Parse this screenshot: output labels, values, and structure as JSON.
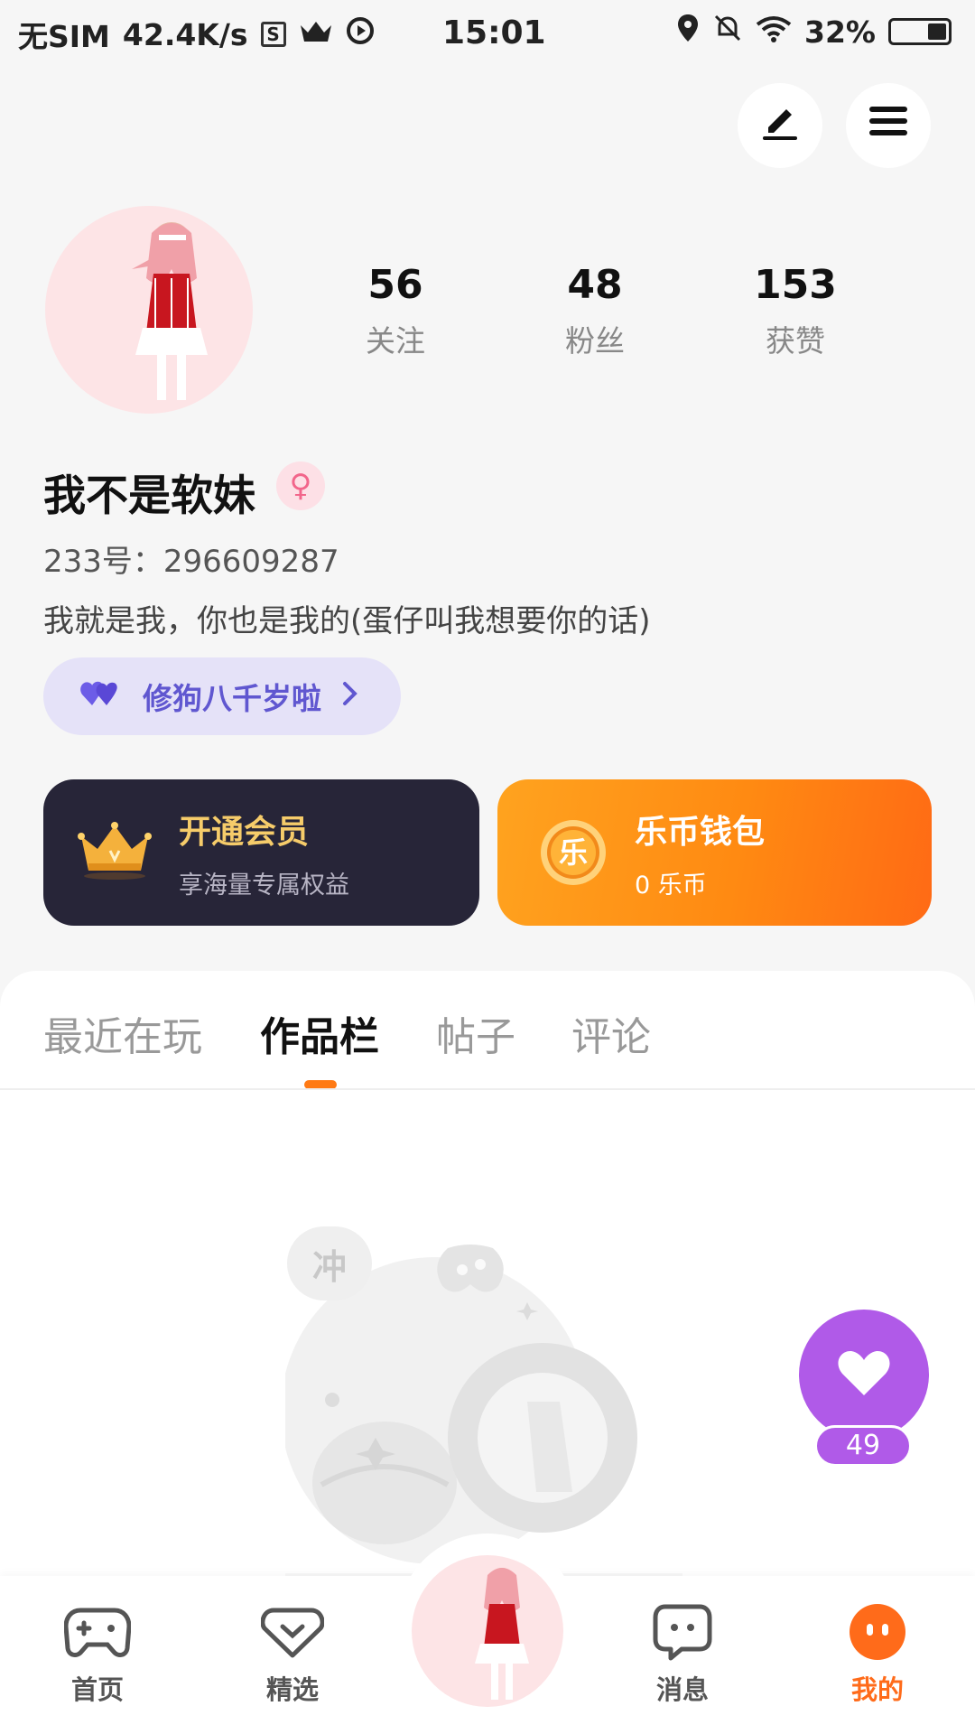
{
  "status_bar": {
    "sim": "无SIM",
    "speed": "42.4K/s",
    "time": "15:01",
    "battery": "32%"
  },
  "profile": {
    "stats": [
      {
        "num": "56",
        "label": "关注"
      },
      {
        "num": "48",
        "label": "粉丝"
      },
      {
        "num": "153",
        "label": "获赞"
      }
    ],
    "nickname": "我不是软妹",
    "uid": "233号：296609287",
    "bio": "我就是我，你也是我的(蛋仔叫我想要你的话)",
    "badge": "修狗八千岁啦"
  },
  "cards": {
    "vip": {
      "title": "开通会员",
      "sub": "享海量专属权益"
    },
    "wallet": {
      "title": "乐币钱包",
      "sub": "0 乐币",
      "coin_char": "乐"
    }
  },
  "tabs": [
    "最近在玩",
    "作品栏",
    "帖子",
    "评论"
  ],
  "empty_state": {
    "bubble": "冲"
  },
  "like": {
    "count": "49"
  },
  "bottom_nav": {
    "home": "首页",
    "featured": "精选",
    "messages": "消息",
    "mine": "我的"
  },
  "colors": {
    "accent_orange": "#ff7a14",
    "like_purple": "#b05ae8",
    "badge_text": "#6057d0",
    "vip_card": "#272538"
  }
}
